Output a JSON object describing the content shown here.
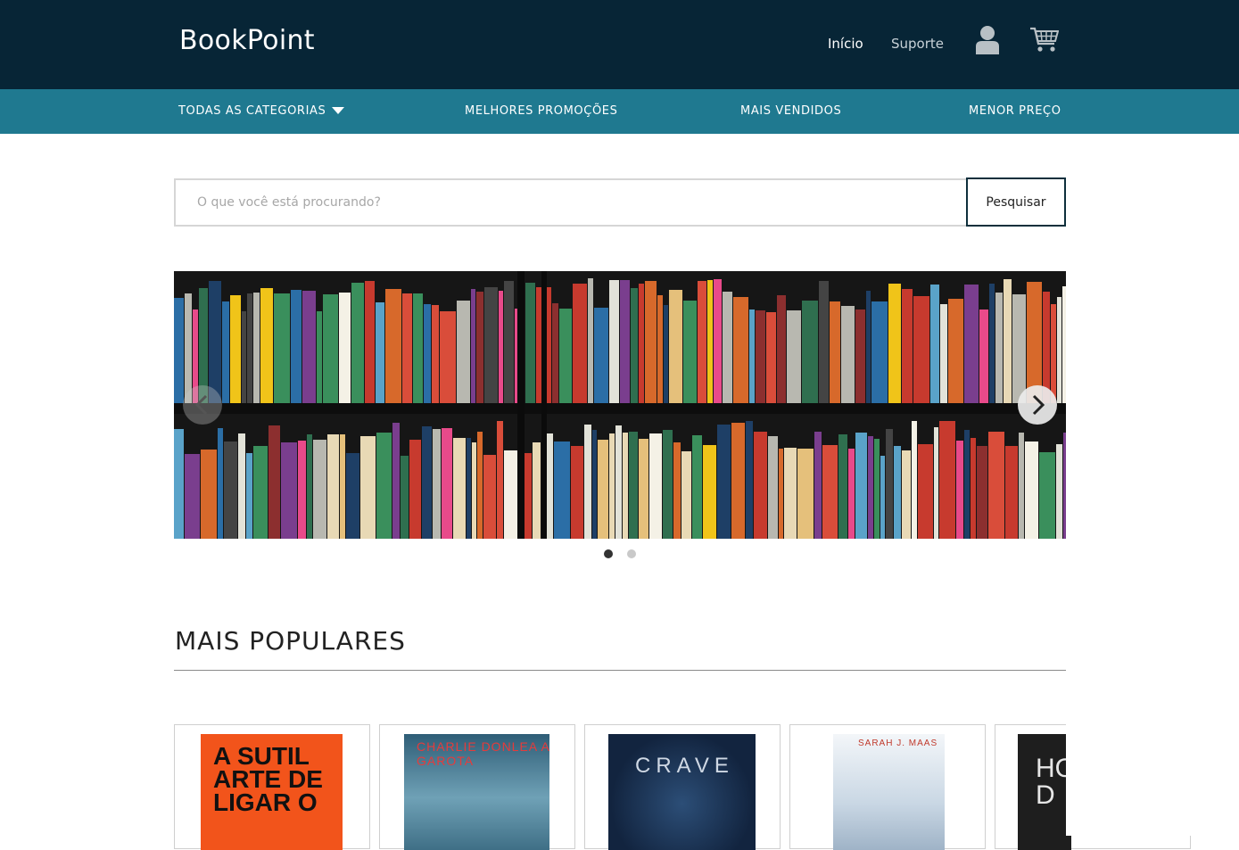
{
  "app": {
    "brand": "BookPoint"
  },
  "topnav": {
    "home": "Início",
    "support": "Suporte"
  },
  "icons": {
    "user": "user-icon",
    "cart": "cart-icon",
    "caret": "caret-down-icon",
    "prev": "chevron-left-icon",
    "next": "chevron-right-icon"
  },
  "categories": {
    "all": "TODAS AS CATEGORIAS",
    "promos": "MELHORES PROMOÇÕES",
    "bestsellers": "MAIS VENDIDOS",
    "lowest": "MENOR PREÇO"
  },
  "search": {
    "placeholder": "O que você está procurando?",
    "value": "",
    "button": "Pesquisar"
  },
  "carousel": {
    "slides": 2,
    "active": 1
  },
  "popular": {
    "title": "MAIS POPULARES",
    "books": [
      {
        "cover_text": "A SUTIL ARTE DE LIGAR O",
        "color": "#f2541b"
      },
      {
        "cover_text": "CHARLIE DONLEA A GAROTA",
        "color": "#3f6f86"
      },
      {
        "cover_text": "CRAVE",
        "color": "#12243f"
      },
      {
        "cover_text": "SARAH J. MAAS",
        "color": "#d9e4ee"
      },
      {
        "cover_text": "HO D",
        "color": "#1e1e1e"
      }
    ]
  },
  "colors": {
    "header": "#072536",
    "category_bar": "#1f7990"
  }
}
